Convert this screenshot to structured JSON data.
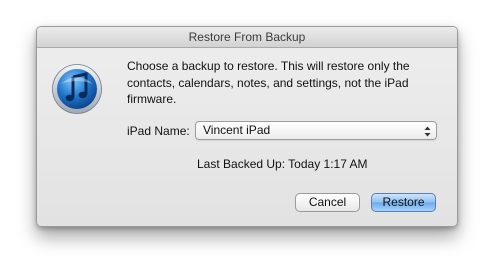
{
  "window": {
    "title": "Restore From Backup"
  },
  "message": "Choose a backup to restore. This will restore only the contacts, calendars, notes, and settings, not the iPad firmware.",
  "device_field": {
    "label": "iPad Name:",
    "selected_value": "Vincent iPad"
  },
  "last_backed_up": "Last Backed Up: Today 1:17 AM",
  "buttons": {
    "cancel_label": "Cancel",
    "restore_label": "Restore"
  },
  "icons": {
    "app": "itunes-icon",
    "select": "up-down-arrows-icon"
  },
  "colors": {
    "default_button": "#8ebff1",
    "itunes_blue": "#1f73c9"
  }
}
